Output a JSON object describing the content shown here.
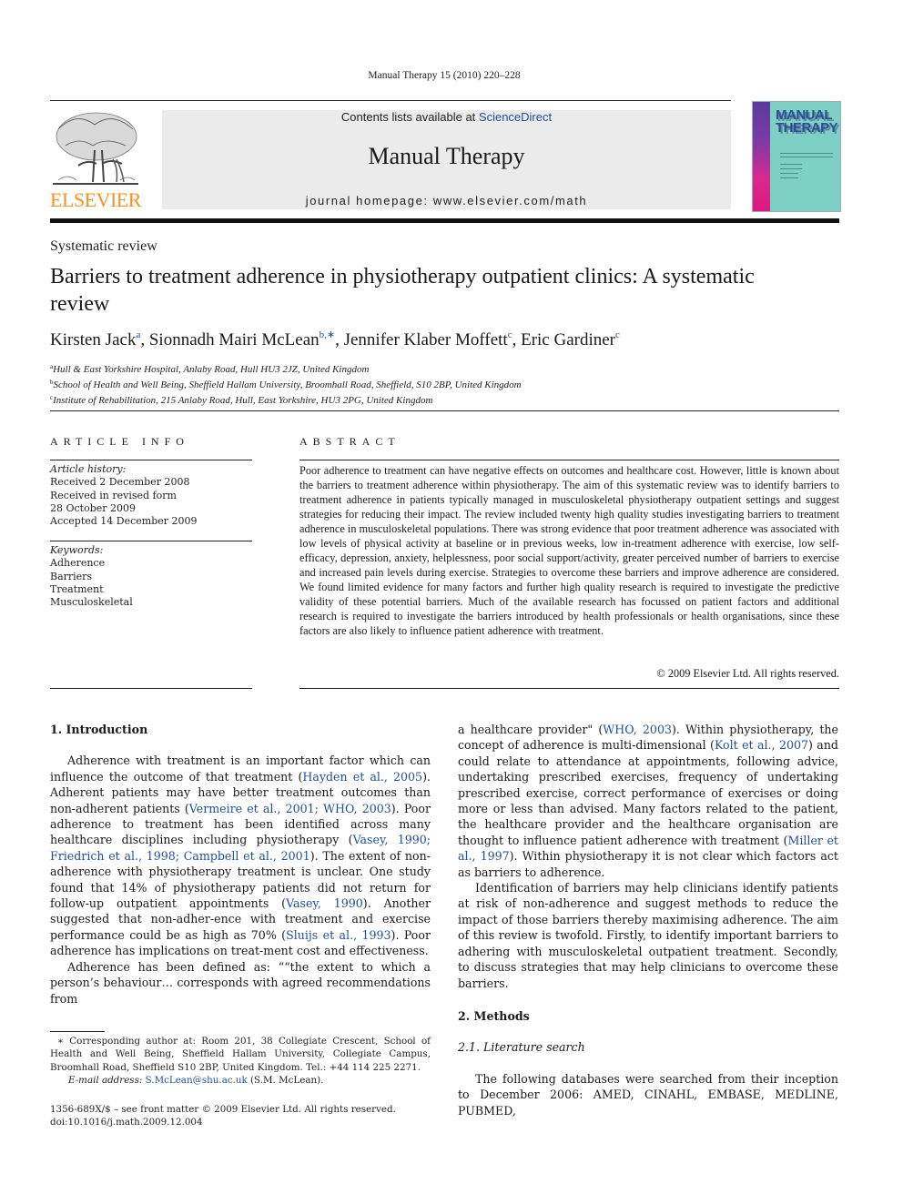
{
  "running_head": "Manual Therapy 15 (2010) 220–228",
  "publisher": {
    "logo_icon": "elsevier-tree-icon",
    "wordmark": "ELSEVIER",
    "brand_color": "#f5921e"
  },
  "banner": {
    "contents_prefix": "Contents lists available at ",
    "sciencedirect_link": "ScienceDirect",
    "journal_title": "Manual Therapy",
    "homepage": "journal homepage: www.elsevier.com/math"
  },
  "cover": {
    "title_line1": "MANUAL",
    "title_line2": "THERAPY",
    "colors": {
      "background": "#7fd0c4",
      "spine_top": "#5b3a9b",
      "spine_bottom": "#e0177f"
    }
  },
  "article": {
    "section_type": "Systematic review",
    "title": "Barriers to treatment adherence in physiotherapy outpatient clinics: A systematic review",
    "authors": [
      {
        "name": "Kirsten Jack",
        "sup": "a"
      },
      {
        "name": "Sionnadh Mairi McLean",
        "sup": "b,∗"
      },
      {
        "name": "Jennifer Klaber Moffett",
        "sup": "c"
      },
      {
        "name": "Eric Gardiner",
        "sup": "c"
      }
    ],
    "affiliations": [
      {
        "sup": "a",
        "text": "Hull & East Yorkshire Hospital, Anlaby Road, Hull HU3 2JZ, United Kingdom"
      },
      {
        "sup": "b",
        "text": "School of Health and Well Being, Sheffield Hallam University, Broomhall Road, Sheffield, S10 2BP, United Kingdom"
      },
      {
        "sup": "c",
        "text": "Institute of Rehabilitation, 215 Anlaby Road, Hull, East Yorkshire, HU3 2PG, United Kingdom"
      }
    ]
  },
  "article_info": {
    "heading": "ARTICLE INFO",
    "history_label": "Article history:",
    "history": [
      "Received 2 December 2008",
      "Received in revised form",
      "28 October 2009",
      "Accepted 14 December 2009"
    ],
    "keywords_label": "Keywords:",
    "keywords": [
      "Adherence",
      "Barriers",
      "Treatment",
      "Musculoskeletal"
    ]
  },
  "abstract": {
    "heading": "ABSTRACT",
    "text": "Poor adherence to treatment can have negative effects on outcomes and healthcare cost. However, little is known about the barriers to treatment adherence within physiotherapy. The aim of this systematic review was to identify barriers to treatment adherence in patients typically managed in musculoskeletal physiotherapy outpatient settings and suggest strategies for reducing their impact. The review included twenty high quality studies investigating barriers to treatment adherence in musculoskeletal populations. There was strong evidence that poor treatment adherence was associated with low levels of physical activity at baseline or in previous weeks, low in-treatment adherence with exercise, low self-efficacy, depression, anxiety, helplessness, poor social support/activity, greater perceived number of barriers to exercise and increased pain levels during exercise. Strategies to overcome these barriers and improve adherence are considered. We found limited evidence for many factors and further high quality research is required to investigate the predictive validity of these potential barriers. Much of the available research has focussed on patient factors and additional research is required to investigate the barriers introduced by health professionals or health organisations, since these factors are also likely to influence patient adherence with treatment.",
    "copyright": "© 2009 Elsevier Ltd. All rights reserved."
  },
  "body": {
    "intro_heading": "1.  Introduction",
    "p1": [
      {
        "t": "Adherence with treatment is an important factor which can influence the outcome of that treatment ("
      },
      {
        "c": "Hayden et al., 2005"
      },
      {
        "t": "). Adherent patients may have better treatment outcomes than non-adherent patients ("
      },
      {
        "c": "Vermeire et al., 2001; WHO, 2003"
      },
      {
        "t": "). Poor adherence to treatment has been identified across many healthcare disciplines including physiotherapy ("
      },
      {
        "c": "Vasey, 1990; Friedrich et al., 1998; Campbell et al., 2001"
      },
      {
        "t": "). The extent of non-adherence with physiotherapy treatment is unclear. One study found that 14% of physiotherapy patients did not return for follow-up outpatient appointments ("
      },
      {
        "c": "Vasey, 1990"
      },
      {
        "t": "). Another suggested that non-adher-ence with treatment and exercise performance could be as high as 70% ("
      },
      {
        "c": "Sluijs et al., 1993"
      },
      {
        "t": "). Poor adherence has implications on treat-ment cost and effectiveness."
      }
    ],
    "p2": [
      {
        "t": "Adherence has been defined as: ““the extent to which a person’s behaviour… corresponds with agreed recommendations from "
      }
    ],
    "p2_cont": [
      {
        "t": "a healthcare provider\" ("
      },
      {
        "c": "WHO, 2003"
      },
      {
        "t": "). Within physiotherapy, the concept of adherence is multi-dimensional ("
      },
      {
        "c": "Kolt et al., 2007"
      },
      {
        "t": ") and could relate to attendance at appointments, following advice, undertaking prescribed exercises, frequency of undertaking prescribed exercise, correct performance of exercises or doing more or less than advised. Many factors related to the patient, the healthcare provider and the healthcare organisation are thought to influence patient adherence with treatment ("
      },
      {
        "c": "Miller et al., 1997"
      },
      {
        "t": "). Within physiotherapy it is not clear which factors act as barriers to adherence."
      }
    ],
    "p3": "Identification of barriers may help clinicians identify patients at risk of non-adherence and suggest methods to reduce the impact of those barriers thereby maximising adherence. The aim of this review is twofold. Firstly, to identify important barriers to adhering with musculoskeletal outpatient treatment. Secondly, to discuss strategies that may help clinicians to overcome these barriers.",
    "methods_heading": "2.  Methods",
    "lit_search_heading": "2.1.  Literature search",
    "p4": "The following databases were searched from their inception to December 2006: AMED, CINAHL, EMBASE, MEDLINE, PUBMED,"
  },
  "footnote": {
    "corresponding": "∗ Corresponding author at: Room 201, 38 Collegiate Crescent, School of Health and Well Being, Sheffield Hallam University, Collegiate Campus, Broomhall Road, Sheffield S10 2BP, United Kingdom. Tel.: +44 114 225 2271.",
    "email_label": "E-mail address:",
    "email": "S.McLean@shu.ac.uk",
    "email_suffix": " (S.M. McLean)."
  },
  "issn_line": "1356-689X/$ – see front matter © 2009 Elsevier Ltd. All rights reserved.",
  "doi": "doi:10.1016/j.math.2009.12.004",
  "colors": {
    "link": "#1f4e9c"
  }
}
